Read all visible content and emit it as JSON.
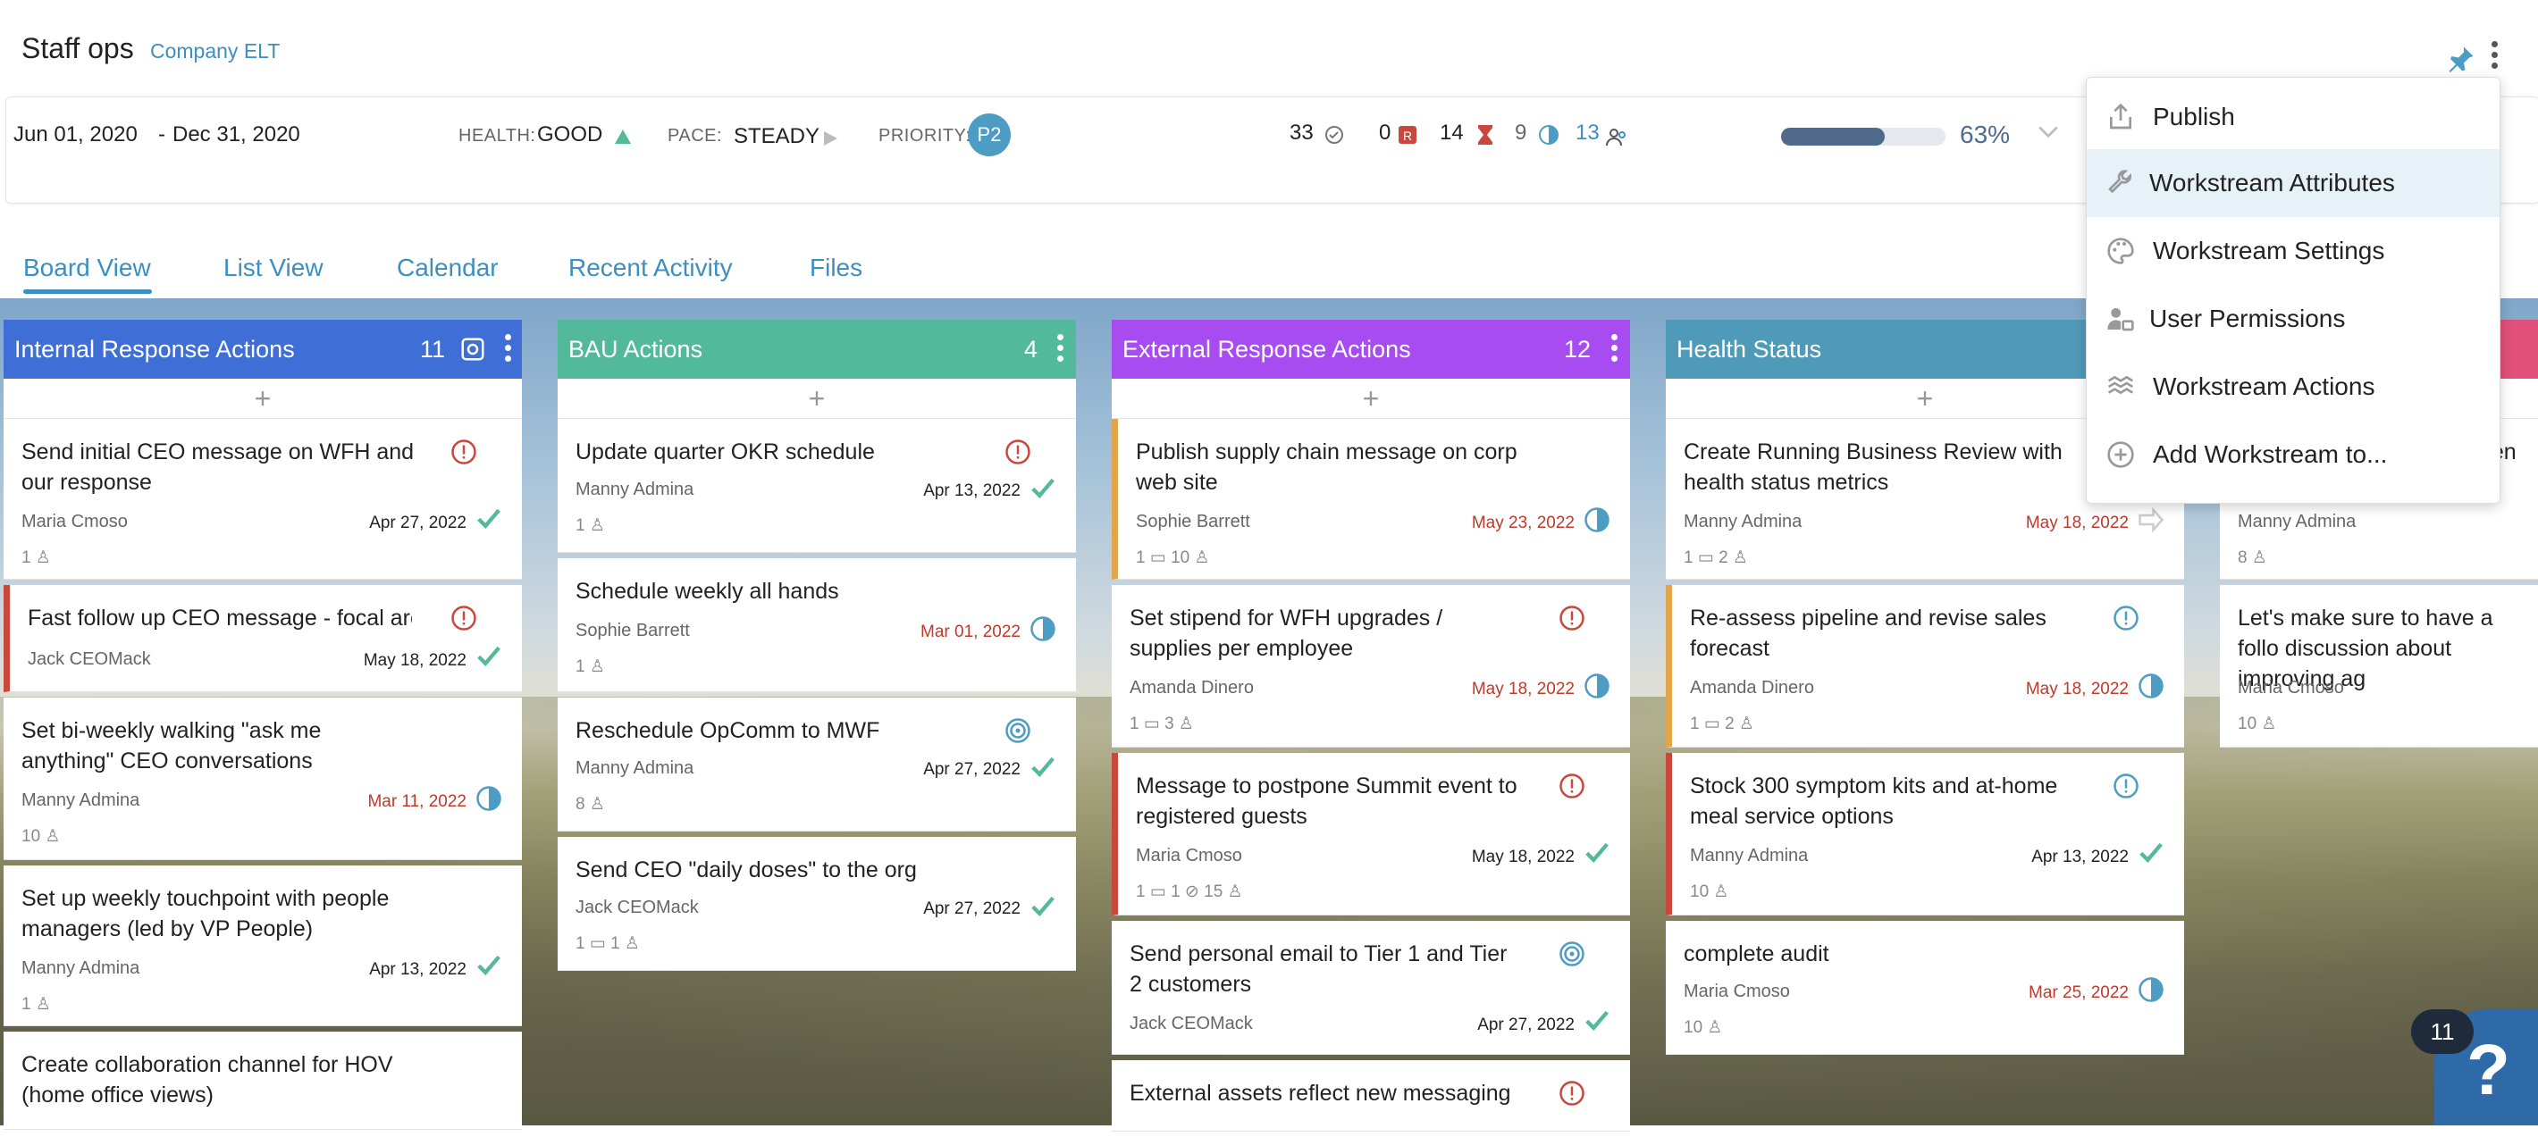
{
  "header": {
    "title": "Staff ops",
    "subtitle": "Company ELT"
  },
  "infobar": {
    "start_date": "Jun 01, 2020",
    "separator": "-",
    "end_date": "Dec 31, 2020",
    "health_label": "HEALTH:",
    "health_value": "GOOD",
    "pace_label": "PACE:",
    "pace_value": "STEADY",
    "priority_label": "PRIORITY:",
    "priority_value": "P2",
    "stats": {
      "completed": "33",
      "blocked": "0",
      "overdue": "14",
      "in_progress": "9",
      "members": "13"
    },
    "progress_percent": 63,
    "progress_text": "63%"
  },
  "tabs": [
    "Board View",
    "List View",
    "Calendar",
    "Recent Activity",
    "Files"
  ],
  "columns": [
    {
      "name": "Internal Response Actions",
      "count": "11",
      "color": "#3f6fd6",
      "cards": [
        {
          "title": "Send initial CEO message on WFH and our response",
          "owner": "Maria Cmoso",
          "date": "Apr 27, 2022",
          "meta": "1 ♙"
        },
        {
          "title": "Fast follow up CEO message - focal are",
          "owner": "Jack CEOMack",
          "date": "May 18, 2022",
          "meta": ""
        },
        {
          "title": "Set bi-weekly walking \"ask me anything\" CEO conversations",
          "owner": "Manny Admina",
          "date": "Mar 11, 2022",
          "meta": "10 ♙"
        },
        {
          "title": "Set up weekly touchpoint with people managers (led by VP People)",
          "owner": "Manny Admina",
          "date": "Apr 13, 2022",
          "meta": "1 ♙"
        },
        {
          "title": "Create collaboration channel for HOV (home office views)",
          "owner": "",
          "date": "",
          "meta": ""
        }
      ]
    },
    {
      "name": "BAU Actions",
      "count": "4",
      "color": "#52b99a",
      "cards": [
        {
          "title": "Update quarter OKR schedule",
          "owner": "Manny Admina",
          "date": "Apr 13, 2022",
          "meta": "1 ♙"
        },
        {
          "title": "Schedule weekly all hands",
          "owner": "Sophie Barrett",
          "date": "Mar 01, 2022",
          "meta": "1 ♙"
        },
        {
          "title": "Reschedule OpComm to MWF",
          "owner": "Manny Admina",
          "date": "Apr 27, 2022",
          "meta": "8 ♙"
        },
        {
          "title": "Send CEO \"daily doses\" to the org",
          "owner": "Jack CEOMack",
          "date": "Apr 27, 2022",
          "meta": "1 ▭   1 ♙"
        }
      ]
    },
    {
      "name": "External Response Actions",
      "count": "12",
      "color": "#a64cf0",
      "cards": [
        {
          "title": "Publish supply chain message on corp web site",
          "owner": "Sophie Barrett",
          "date": "May 23, 2022",
          "meta": "1 ▭   10 ♙"
        },
        {
          "title": "Set stipend for WFH upgrades / supplies per employee",
          "owner": "Amanda Dinero",
          "date": "May 18, 2022",
          "meta": "1 ▭   3 ♙"
        },
        {
          "title": "Message to postpone Summit event to registered guests",
          "owner": "Maria Cmoso",
          "date": "May 18, 2022",
          "meta": "1 ▭   1 ⊘   15 ♙"
        },
        {
          "title": "Send personal email to Tier 1 and Tier 2 customers",
          "owner": "Jack CEOMack",
          "date": "Apr 27, 2022",
          "meta": ""
        },
        {
          "title": "External assets reflect new messaging",
          "owner": "",
          "date": "",
          "meta": ""
        }
      ]
    },
    {
      "name": "Health Status",
      "count": "",
      "color": "#4f9ab8",
      "cards": [
        {
          "title": "Create Running Business Review with health status metrics",
          "owner": "Manny Admina",
          "date": "May 18, 2022",
          "meta": "1 ▭   2 ♙"
        },
        {
          "title": "Re-assess pipeline and revise sales forecast",
          "owner": "Amanda Dinero",
          "date": "May 18, 2022",
          "meta": "1 ▭   2 ♙"
        },
        {
          "title": "Stock 300 symptom kits and at-home meal service options",
          "owner": "Manny Admina",
          "date": "Apr 13, 2022",
          "meta": "10 ♙"
        },
        {
          "title": "complete audit",
          "owner": "Maria Cmoso",
          "date": "Mar 25, 2022",
          "meta": "10 ♙"
        }
      ]
    },
    {
      "name": "",
      "count": "",
      "color": "#e0507a",
      "cards": [
        {
          "title": "een",
          "owner": "Manny Admina",
          "date": "",
          "meta": "8 ♙"
        },
        {
          "title": "Let's make sure to have a follo discussion about improving ag",
          "owner": "Maria Cmoso",
          "date": "",
          "meta": "10 ♙"
        }
      ]
    }
  ],
  "menu": {
    "items": [
      {
        "label": "Publish",
        "icon": "share-icon"
      },
      {
        "label": "Workstream Attributes",
        "icon": "wrench-icon"
      },
      {
        "label": "Workstream Settings",
        "icon": "palette-icon"
      },
      {
        "label": "User Permissions",
        "icon": "user-lock-icon"
      },
      {
        "label": "Workstream Actions",
        "icon": "layers-icon"
      },
      {
        "label": "Add Workstream to...",
        "icon": "plus-circle-icon"
      }
    ]
  },
  "help": {
    "badge": "11",
    "glyph": "?"
  }
}
